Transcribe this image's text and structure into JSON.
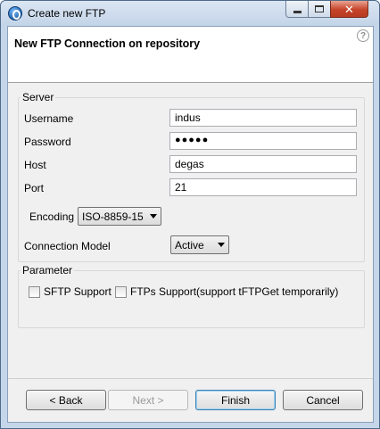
{
  "window": {
    "title": "Create new FTP"
  },
  "header": {
    "title": "New FTP Connection on repository",
    "help_glyph": "?"
  },
  "server": {
    "legend": "Server",
    "username_label": "Username",
    "username_value": "indus",
    "password_label": "Password",
    "password_value": "●●●●●",
    "host_label": "Host",
    "host_value": "degas",
    "port_label": "Port",
    "port_value": "21",
    "encoding_label": "Encoding",
    "encoding_value": "ISO-8859-15",
    "connection_model_label": "Connection Model",
    "connection_model_value": "Active"
  },
  "parameter": {
    "legend": "Parameter",
    "sftp_label": "SFTP Support",
    "sftp_checked": false,
    "ftps_label": "FTPs Support(support tFTPGet temporarily)",
    "ftps_checked": false
  },
  "buttons": {
    "back": "< Back",
    "next": "Next >",
    "finish": "Finish",
    "cancel": "Cancel"
  },
  "window_controls": {
    "close_glyph": "✕"
  },
  "icons": {
    "app": "talend-app-icon",
    "help": "help-icon",
    "minimize": "minimize-icon",
    "maximize": "maximize-icon",
    "close": "close-icon",
    "dropdown": "chevron-down-icon"
  }
}
